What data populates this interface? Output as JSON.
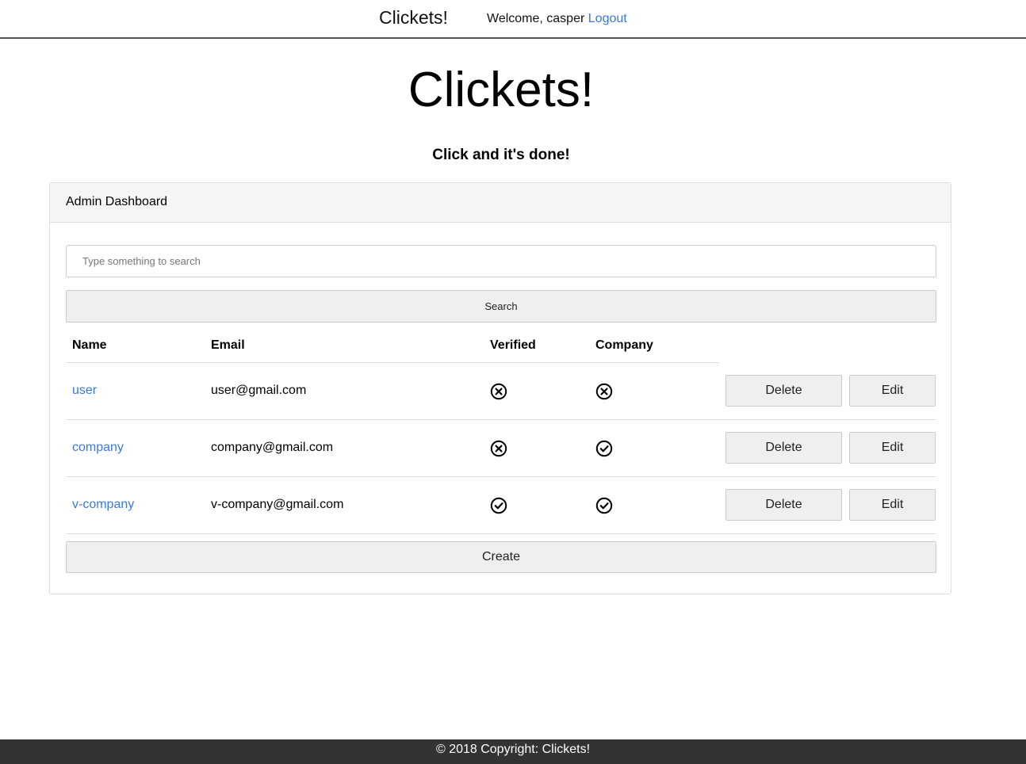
{
  "navbar": {
    "brand": "Clickets!",
    "welcome_text": "Welcome, casper",
    "logout_label": "Logout"
  },
  "hero": {
    "title": "Clickets!",
    "tagline": "Click and it's done!"
  },
  "panel": {
    "heading": "Admin Dashboard",
    "search": {
      "placeholder": "Type something to search",
      "value": "",
      "button_label": "Search"
    },
    "table": {
      "columns": [
        "Name",
        "Email",
        "Verified",
        "Company"
      ],
      "rows": [
        {
          "name": "user",
          "email": "user@gmail.com",
          "verified": "x-circle-icon",
          "company": "x-circle-icon",
          "delete_label": "Delete",
          "edit_label": "Edit"
        },
        {
          "name": "company",
          "email": "company@gmail.com",
          "verified": "x-circle-icon",
          "company": "check-circle-icon",
          "delete_label": "Delete",
          "edit_label": "Edit"
        },
        {
          "name": "v-company",
          "email": "v-company@gmail.com",
          "verified": "check-circle-icon",
          "company": "check-circle-icon",
          "delete_label": "Delete",
          "edit_label": "Edit"
        }
      ]
    },
    "create_label": "Create"
  },
  "footer": {
    "text": "© 2018 Copyright: Clickets!"
  },
  "colors": {
    "link": "#3a78e0",
    "footer_bg": "#333333",
    "button_bg": "#efefef"
  }
}
